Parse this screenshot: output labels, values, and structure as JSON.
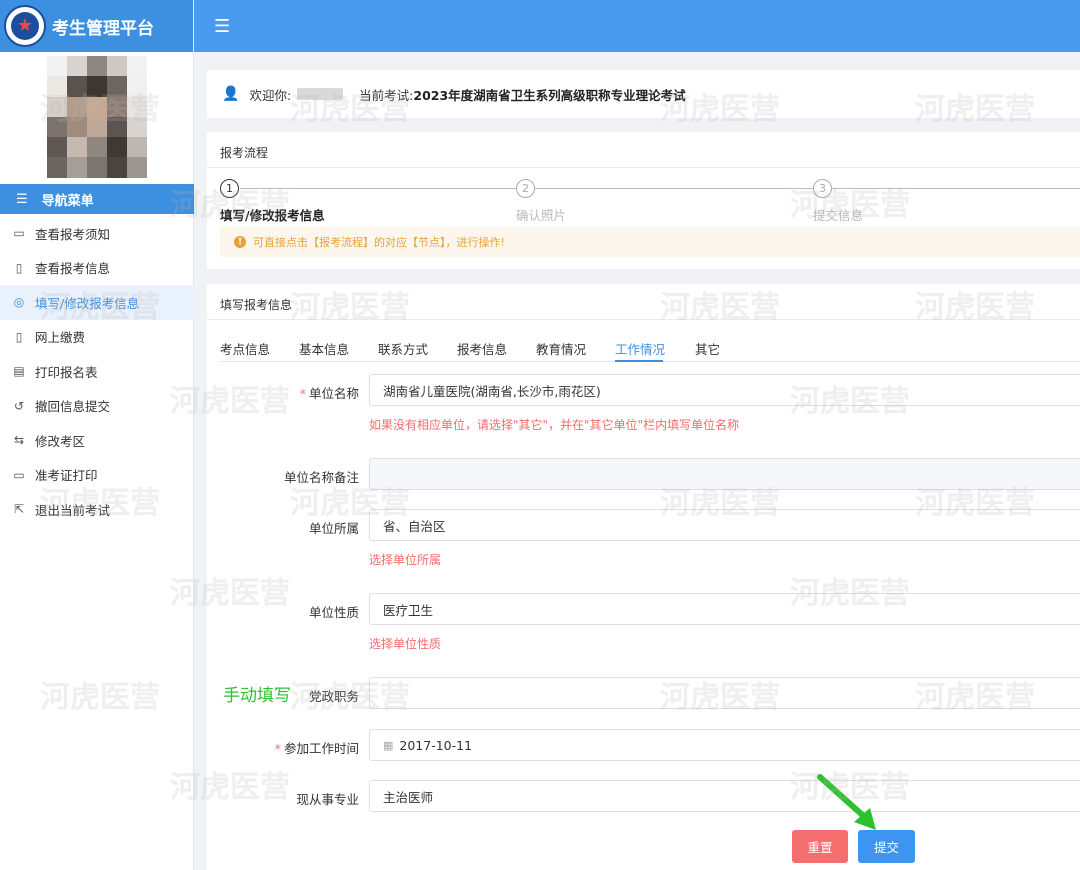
{
  "app": {
    "title": "考生管理平台"
  },
  "nav": {
    "header": "导航菜单",
    "items": [
      {
        "label": "查看报考须知",
        "icon": "message-icon"
      },
      {
        "label": "查看报考信息",
        "icon": "file-icon"
      },
      {
        "label": "填写/修改报考信息",
        "icon": "check-circle-icon",
        "active": true
      },
      {
        "label": "网上缴费",
        "icon": "file-icon"
      },
      {
        "label": "打印报名表",
        "icon": "print-icon"
      },
      {
        "label": "撤回信息提交",
        "icon": "undo-icon"
      },
      {
        "label": "修改考区",
        "icon": "swap-icon"
      },
      {
        "label": "准考证打印",
        "icon": "card-icon"
      },
      {
        "label": "退出当前考试",
        "icon": "exit-icon"
      }
    ]
  },
  "welcome": {
    "greeting": "欢迎你:",
    "exam_prefix": "当前考试:",
    "exam_name": "2023年度湖南省卫生系列高级职称专业理论考试"
  },
  "flow": {
    "title": "报考流程",
    "steps": [
      {
        "num": "1",
        "label": "填写/修改报考信息"
      },
      {
        "num": "2",
        "label": "确认照片"
      },
      {
        "num": "3",
        "label": "提交信息"
      }
    ],
    "current_step": 1,
    "tip": "可直接点击【报考流程】的对应【节点】，进行操作!"
  },
  "form": {
    "title": "填写报考信息",
    "tabs": [
      "考点信息",
      "基本信息",
      "联系方式",
      "报考信息",
      "教育情况",
      "工作情况",
      "其它"
    ],
    "active_tab": "工作情况",
    "fields": {
      "unit_name": {
        "label": "单位名称",
        "value": "湖南省儿童医院(湖南省,长沙市,雨花区)",
        "hint": "如果没有相应单位，请选择\"其它\"，并在\"其它单位\"栏内填写单位名称"
      },
      "unit_note": {
        "label": "单位名称备注",
        "value": ""
      },
      "unit_affiliation": {
        "label": "单位所属",
        "value": "省、自治区",
        "hint": "选择单位所属"
      },
      "unit_nature": {
        "label": "单位性质",
        "value": "医疗卫生",
        "hint": "选择单位性质"
      },
      "party_post": {
        "label": "党政职务",
        "value": "",
        "annotation": "手动填写"
      },
      "work_start": {
        "label": "参加工作时间",
        "value": "2017-10-11"
      },
      "specialty": {
        "label": "现从事专业",
        "value": "主治医师"
      }
    },
    "buttons": {
      "reset": "重置",
      "submit": "提交"
    }
  },
  "watermark": "河虎医营",
  "colors": {
    "primary": "#3d8fe0",
    "danger": "#f56c6c",
    "warning": "#e6a23c",
    "annotation": "#2ec12e"
  }
}
